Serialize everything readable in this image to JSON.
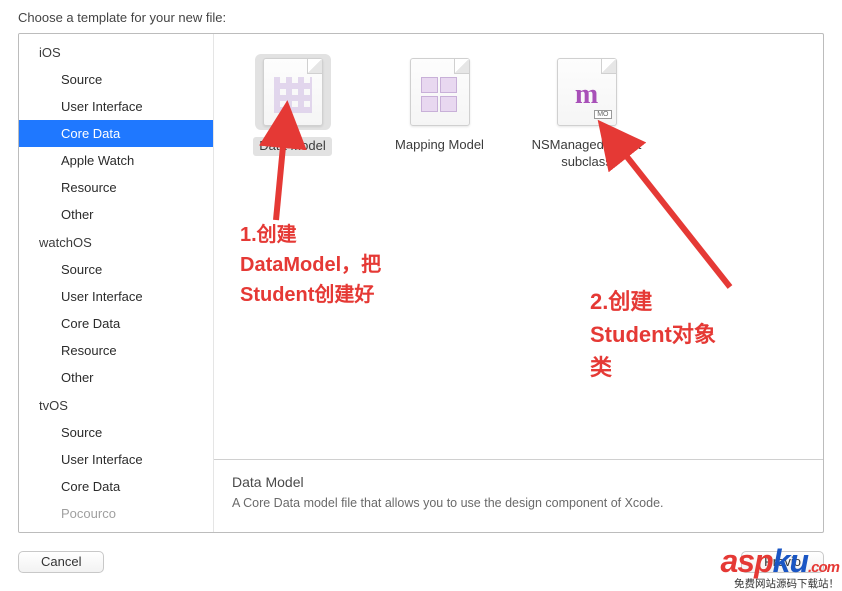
{
  "header": {
    "title": "Choose a template for your new file:"
  },
  "sidebar": [
    {
      "platform": "iOS",
      "items": [
        "Source",
        "User Interface",
        "Core Data",
        "Apple Watch",
        "Resource",
        "Other"
      ],
      "selected": 2
    },
    {
      "platform": "watchOS",
      "items": [
        "Source",
        "User Interface",
        "Core Data",
        "Resource",
        "Other"
      ]
    },
    {
      "platform": "tvOS",
      "items": [
        "Source",
        "User Interface",
        "Core Data",
        "Pocourco"
      ]
    }
  ],
  "templates": [
    {
      "id": "data-model",
      "label": "Data Model",
      "iconClass": "icon-datamodel",
      "selected": true
    },
    {
      "id": "mapping-model",
      "label": "Mapping Model",
      "iconClass": "icon-mapping"
    },
    {
      "id": "nsmanagedobject-subclass",
      "label": "NSManagedObject subclass",
      "iconClass": "icon-subclass"
    }
  ],
  "description": {
    "title": "Data Model",
    "text": "A Core Data model file that allows you to use the design component of Xcode."
  },
  "footer": {
    "cancel": "Cancel",
    "previous": "Previo"
  },
  "annotations": {
    "a1_l1": "1.创建",
    "a1_l2": "DataModel，把",
    "a1_l3": "Student创建好",
    "a2_l1": "2.创建",
    "a2_l2": "Student对象",
    "a2_l3": "类"
  },
  "watermark": {
    "red1": "asp",
    "blue": "ku",
    "com": ".com",
    "sub": "免费网站源码下载站！"
  }
}
